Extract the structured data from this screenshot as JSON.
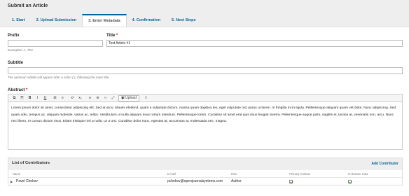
{
  "header": {
    "title": "Submit an Article",
    "tabs": [
      {
        "label": "1. Start"
      },
      {
        "label": "2. Upload Submission"
      },
      {
        "label": "3. Enter Metadata"
      },
      {
        "label": "4. Confirmation"
      },
      {
        "label": "5. Next Steps"
      }
    ],
    "active_tab": 2
  },
  "form": {
    "prefix": {
      "label": "Prefix",
      "value": "",
      "hint": "Examples: A, The"
    },
    "title": {
      "label": "Title",
      "required_mark": "*",
      "value": "Test Article #1"
    },
    "subtitle": {
      "label": "Subtitle",
      "value": "",
      "hint": "The optional subtitle will appear after a colon (:), following the main title."
    },
    "abstract": {
      "label": "Abstract",
      "required_mark": "*",
      "upload_label": "Upload",
      "text": "Lorem ipsum dolor sit amet, consectetur adipiscing elit. Sed at arcu. Mauris eleifend, quam a vulputate dictum, massa quam dapibus leo, eget vulputate orci purus ut lorem. In fringilla mi in ligula. Pellentesque aliquam quam vel dolor. Nunc adipiscing. Sed quam odio, tempus ac, aliquam molestie, varius ac, tellus. Vestibulum ut nulla aliquam risus rutrum interdum. Pellentesque lorem. Curabitur sit amet erat quis risus feugiat viverra. Pellentesque augue justo, sagittis et, lacinia at, venenatis non, arcu. Nunc nec libero. In cursus dictum risus. Etiam tristique nisl a nulla. Ut a orci. Curabitur dolor nunc, egestas at, accumsan at, malesuada nec, magna."
    }
  },
  "contributors": {
    "title": "List of Contributors",
    "add_label": "Add Contributor",
    "columns": [
      "Name",
      "E-mail",
      "Role",
      "Primary Contact",
      "In Browse Lists"
    ],
    "rows": [
      {
        "name": "Pavel Chekov",
        "email": "pchekov@openjournalsystems.com",
        "role": "Author",
        "primary_contact": true,
        "in_browse_lists": true
      }
    ]
  },
  "icons": {
    "toolbar": [
      "copy-icon",
      "paste-icon",
      "bold-icon",
      "italic-icon",
      "underline-icon",
      "bullet-list-icon",
      "numbered-list-icon",
      "superscript-icon",
      "subscript-icon",
      "link-icon",
      "unlink-icon",
      "code-icon",
      "fullscreen-icon",
      "image-upload-icon"
    ]
  }
}
